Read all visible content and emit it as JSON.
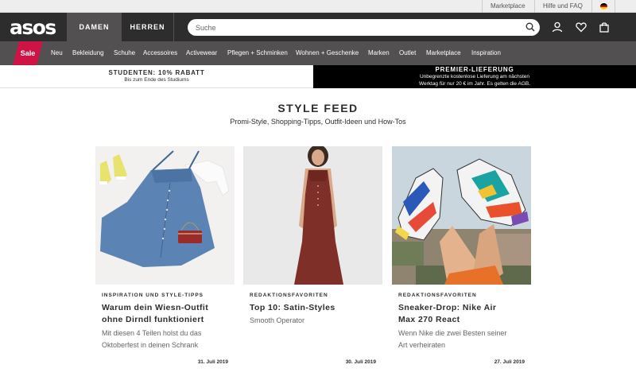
{
  "utility": {
    "marketplace": "Marketplace",
    "help": "Hilfe und FAQ",
    "flag_icon": "germany-flag-icon"
  },
  "header": {
    "logo": "asos",
    "tabs": [
      "DAMEN",
      "HERREN"
    ],
    "search_placeholder": "Suche",
    "icons": [
      "account-icon",
      "heart-icon",
      "bag-icon"
    ]
  },
  "nav": {
    "sale": "Sale",
    "items": [
      "Neu",
      "Bekleidung",
      "Schuhe",
      "Accessoires",
      "Activewear",
      "Pflegen + Schminken",
      "Wohnen + Geschenke",
      "Marken",
      "Outlet",
      "Marketplace",
      "Inspiration"
    ]
  },
  "promo": {
    "left_title": "STUDENTEN: 10% RABATT",
    "left_sub": "Bis zum Ende des Studiums",
    "right_title": "PREMIER-LIEFERUNG",
    "right_sub_1": "Unbegrenzte kostenlose Lieferung am nächsten",
    "right_sub_2": "Werktag für nur 20 € im Jahr. Es gelten die AGB."
  },
  "feed": {
    "title": "STYLE FEED",
    "subtitle": "Promi-Style, Shopping-Tipps, Outfit-Ideen und How-Tos",
    "cards": [
      {
        "kicker": "INSPIRATION UND STYLE-TIPPS",
        "title_1": "Warum dein Wiesn-Outfit",
        "title_2": "ohne Dirndl funktioniert",
        "desc_1": "Mit diesen 4 Teilen holst du das",
        "desc_2": "Oktoberfest in deinen Schrank",
        "date": "31. Juli 2019"
      },
      {
        "kicker": "REDAKTIONSFAVORITEN",
        "title_1": "Top 10: Satin-Styles",
        "title_2": "",
        "desc_1": "Smooth Operator",
        "desc_2": "",
        "date": "30. Juli 2019"
      },
      {
        "kicker": "REDAKTIONSFAVORITEN",
        "title_1": "Sneaker-Drop: Nike Air",
        "title_2": "Max 270 React",
        "desc_1": "Wenn Nike die zwei Besten seiner",
        "desc_2": "Art verheiraten",
        "date": "27. Juli 2019"
      }
    ]
  },
  "colors": {
    "header_bg": "#2d2d2d",
    "nav_bg": "#525050",
    "sale_red": "#d01345",
    "promo_black": "#000000"
  }
}
